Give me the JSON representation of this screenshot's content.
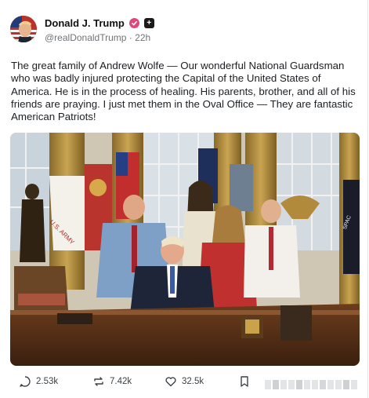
{
  "post": {
    "author_name": "Donald J. Trump",
    "handle": "@realDonaldTrump",
    "separator": "·",
    "time_ago": "22h",
    "verified_badge_icon": "verified-check-icon",
    "plus_icon_label": "+",
    "text": "The great family of Andrew Wolfe — Our wonderful National Guardsman who was badly injured protecting the Capital of the United States of America. He is in the process of healing. His parents, brother, and all of his friends are praying. I just met them in the Oval Office — They are fantastic American Patriots!",
    "photo": {
      "flag_texts": [
        "U.S. ARMY",
        "SPAC"
      ]
    }
  },
  "actions": {
    "replies": "2.53k",
    "reposts": "7.42k",
    "likes": "32.5k",
    "reply_icon": "comment-icon",
    "repost_icon": "repost-icon",
    "like_icon": "heart-icon",
    "bookmark_icon": "bookmark-icon"
  },
  "colors": {
    "badge": "#e2477a",
    "handle": "#6f7479",
    "text": "#1c1f23"
  }
}
